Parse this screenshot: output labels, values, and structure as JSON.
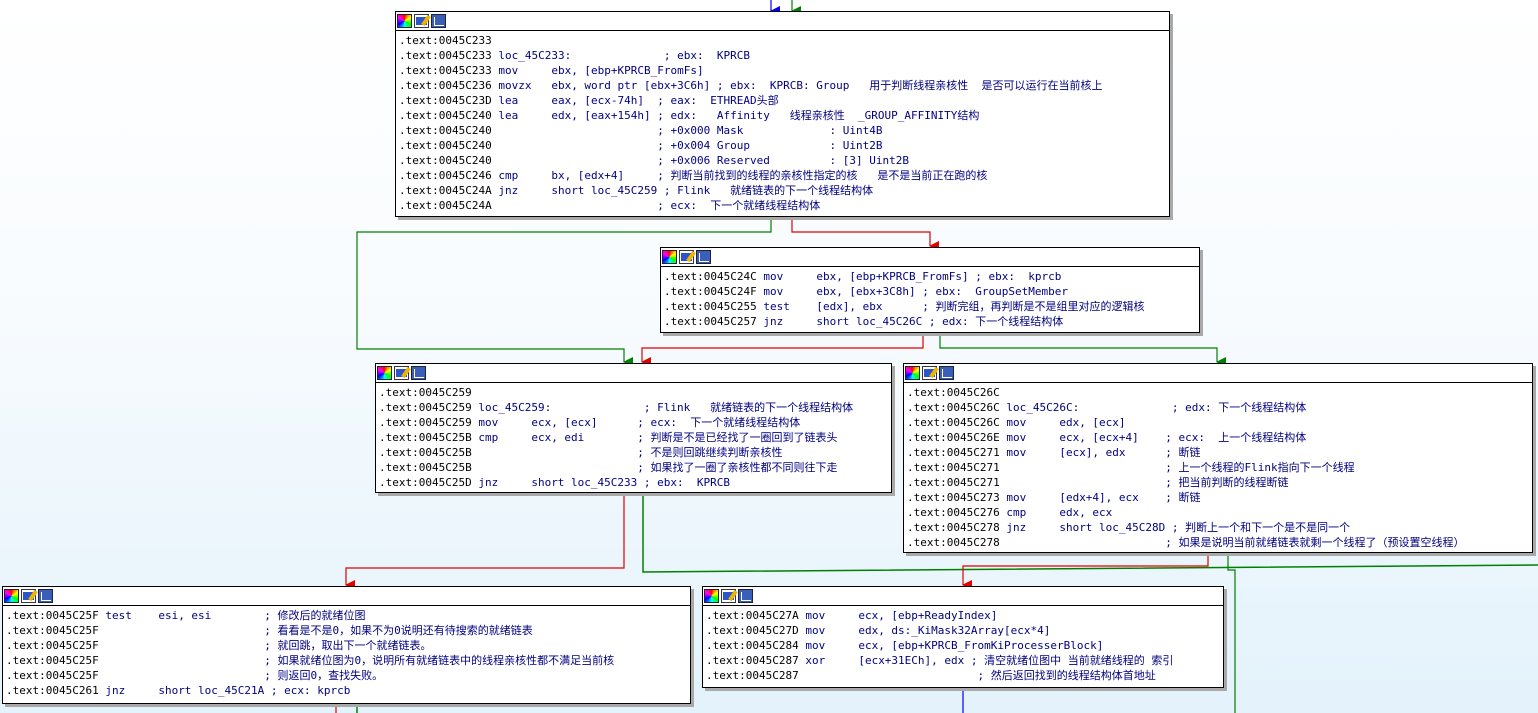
{
  "blocks": [
    {
      "id": "loc_45C233",
      "lines": [
        [
          ".text:0045C233",
          ""
        ],
        [
          ".text:0045C233",
          " loc_45C233:              ; ebx:  KPRCB"
        ],
        [
          ".text:0045C233",
          " mov     ebx, [ebp+KPRCB_FromFs]"
        ],
        [
          ".text:0045C236",
          " movzx   ebx, word ptr [ebx+3C6h] ; ebx:  KPRCB: Group   用于判断线程亲核性  是否可以运行在当前核上"
        ],
        [
          ".text:0045C23D",
          " lea     eax, [ecx-74h]  ; eax:  ETHREAD头部"
        ],
        [
          ".text:0045C240",
          " lea     edx, [eax+154h] ; edx:   Affinity   线程亲核性  _GROUP_AFFINITY结构"
        ],
        [
          ".text:0045C240",
          "                         ; +0x000 Mask             : Uint4B"
        ],
        [
          ".text:0045C240",
          "                         ; +0x004 Group            : Uint2B"
        ],
        [
          ".text:0045C240",
          "                         ; +0x006 Reserved         : [3] Uint2B"
        ],
        [
          ".text:0045C246",
          " cmp     bx, [edx+4]     ; 判断当前找到的线程的亲核性指定的核   是不是当前正在跑的核"
        ],
        [
          ".text:0045C24A",
          " jnz     short loc_45C259 ; Flink   就绪链表的下一个线程结构体"
        ],
        [
          ".text:0045C24A",
          "                         ; ecx:  下一个就绪线程结构体"
        ]
      ]
    },
    {
      "id": "block_45C24C",
      "lines": [
        [
          ".text:0045C24C",
          " mov     ebx, [ebp+KPRCB_FromFs] ; ebx:  kprcb"
        ],
        [
          ".text:0045C24F",
          " mov     ebx, [ebx+3C8h] ; ebx:  GroupSetMember"
        ],
        [
          ".text:0045C255",
          " test    [edx], ebx      ; 判断完组，再判断是不是组里对应的逻辑核"
        ],
        [
          ".text:0045C257",
          " jnz     short loc_45C26C ; edx: 下一个线程结构体"
        ]
      ]
    },
    {
      "id": "loc_45C259",
      "lines": [
        [
          ".text:0045C259",
          ""
        ],
        [
          ".text:0045C259",
          " loc_45C259:              ; Flink   就绪链表的下一个线程结构体"
        ],
        [
          ".text:0045C259",
          " mov     ecx, [ecx]      ; ecx:  下一个就绪线程结构体"
        ],
        [
          ".text:0045C25B",
          " cmp     ecx, edi        ; 判断是不是已经找了一圈回到了链表头"
        ],
        [
          ".text:0045C25B",
          "                         ; 不是则回跳继续判断亲核性"
        ],
        [
          ".text:0045C25B",
          "                         ; 如果找了一圈了亲核性都不同则往下走"
        ],
        [
          ".text:0045C25D",
          " jnz     short loc_45C233 ; ebx:  KPRCB"
        ]
      ]
    },
    {
      "id": "loc_45C26C",
      "lines": [
        [
          ".text:0045C26C",
          ""
        ],
        [
          ".text:0045C26C",
          " loc_45C26C:              ; edx: 下一个线程结构体"
        ],
        [
          ".text:0045C26C",
          " mov     edx, [ecx]"
        ],
        [
          ".text:0045C26E",
          " mov     ecx, [ecx+4]    ; ecx:  上一个线程结构体"
        ],
        [
          ".text:0045C271",
          " mov     [ecx], edx      ; 断链"
        ],
        [
          ".text:0045C271",
          "                         ; 上一个线程的Flink指向下一个线程"
        ],
        [
          ".text:0045C271",
          "                         ; 把当前判断的线程断链"
        ],
        [
          ".text:0045C273",
          " mov     [edx+4], ecx    ; 断链"
        ],
        [
          ".text:0045C276",
          " cmp     edx, ecx"
        ],
        [
          ".text:0045C278",
          " jnz     short loc_45C28D ; 判断上一个和下一个是不是同一个"
        ],
        [
          ".text:0045C278",
          "                         ; 如果是说明当前就绪链表就剩一个线程了（预设置空线程）"
        ]
      ]
    },
    {
      "id": "block_45C25F",
      "lines": [
        [
          ".text:0045C25F",
          " test    esi, esi        ; 修改后的就绪位图"
        ],
        [
          ".text:0045C25F",
          "                         ; 看看是不是0，如果不为0说明还有待搜索的就绪链表"
        ],
        [
          ".text:0045C25F",
          "                         ; 就回跳，取出下一个就绪链表。"
        ],
        [
          ".text:0045C25F",
          "                         ; 如果就绪位图为0，说明所有就绪链表中的线程亲核性都不满足当前核"
        ],
        [
          ".text:0045C25F",
          "                         ; 则返回0，查找失败。"
        ],
        [
          ".text:0045C261",
          " jnz     short loc_45C21A ; ecx: kprcb"
        ]
      ]
    },
    {
      "id": "block_45C27A",
      "lines": [
        [
          ".text:0045C27A",
          " mov     ecx, [ebp+ReadyIndex]"
        ],
        [
          ".text:0045C27D",
          " mov     edx, ds:_KiMask32Array[ecx*4]"
        ],
        [
          ".text:0045C284",
          " mov     ecx, [ebp+KPRCB_FromKiProcesserBlock]"
        ],
        [
          ".text:0045C287",
          " xor     [ecx+31ECh], edx ; 清空就绪位图中 当前就绪线程的 索引"
        ],
        [
          ".text:0045C287",
          "                           ; 然后返回找到的线程结构体首地址"
        ]
      ]
    }
  ],
  "header_icons": [
    "color-icon",
    "rename-icon",
    "graph-icon"
  ],
  "edge_colors": {
    "taken": "#008000",
    "fallthrough": "#e00000",
    "unconditional": "#0000ff"
  }
}
